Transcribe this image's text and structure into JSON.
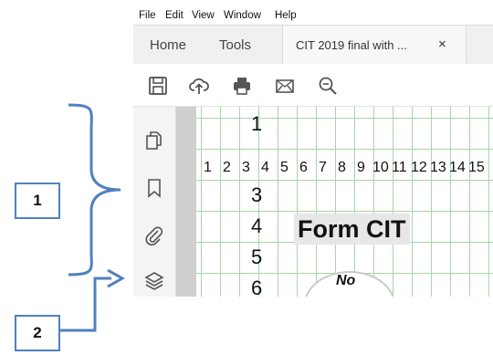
{
  "menu": [
    "File",
    "Edit",
    "View",
    "Window",
    "Help"
  ],
  "tabs": {
    "home": "Home",
    "tools": "Tools",
    "document": "CIT 2019 final with ...",
    "close": "×"
  },
  "toolbar_icons": [
    "save-icon",
    "upload-icon",
    "print-icon",
    "email-icon",
    "search-zoom-icon"
  ],
  "sidebar_icons": [
    "page-thumbnails-icon",
    "bookmark-icon",
    "attachment-icon",
    "layers-icon"
  ],
  "document": {
    "row_numbers": [
      "1",
      "3",
      "4",
      "5",
      "6"
    ],
    "column_numbers": [
      "1",
      "2",
      "3",
      "4",
      "5",
      "6",
      "7",
      "8",
      "9",
      "10",
      "11",
      "12",
      "13",
      "14",
      "15"
    ],
    "title": "Form CIT",
    "oval_text": "No"
  },
  "callouts": {
    "one": "1",
    "two": "2"
  },
  "colors": {
    "callout_blue": "#4f81bd",
    "grid_green": "#a6d6a6"
  }
}
